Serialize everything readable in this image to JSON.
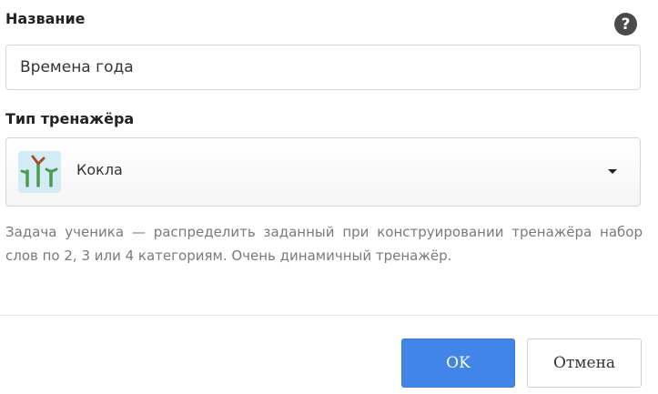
{
  "form": {
    "name_label": "Название",
    "name_value": "Времена года",
    "type_label": "Тип тренажёра",
    "help_icon_glyph": "?"
  },
  "trainer_select": {
    "selected_label": "Кокла",
    "icon": "trainer-thumbnail-icon",
    "description": "Задача ученика — распределить заданный при конструировании тренажёра набор слов по 2, 3 или 4 категориям. Очень динамичный тренажёр."
  },
  "buttons": {
    "ok_label": "OK",
    "cancel_label": "Отмена"
  },
  "colors": {
    "primary": "#4285e9",
    "thumb_bg": "#d4ecf6",
    "plant_green": "#4e9a50",
    "plant_brown": "#a0522d"
  }
}
